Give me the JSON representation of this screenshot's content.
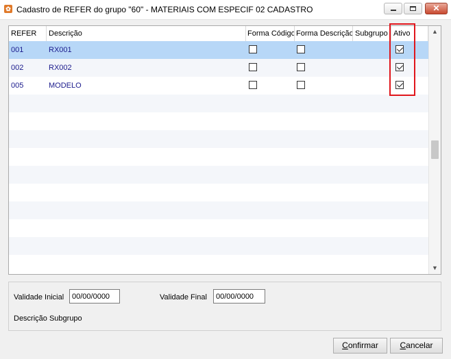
{
  "window": {
    "title": "Cadastro de REFER do grupo \"60\" - MATERIAIS COM ESPECIF 02 CADASTRO",
    "icon": "app-icon",
    "close_glyph": "✕"
  },
  "grid": {
    "columns": [
      "REFER",
      "Descrição",
      "Forma Código",
      "Forma Descrição",
      "Subgrupo",
      "Ativo"
    ],
    "rows": [
      {
        "refer": "001",
        "descricao": "RX001",
        "forma_codigo": false,
        "forma_descricao": false,
        "subgrupo": "",
        "ativo": true,
        "selected": true
      },
      {
        "refer": "002",
        "descricao": "RX002",
        "forma_codigo": false,
        "forma_descricao": false,
        "subgrupo": "",
        "ativo": true,
        "selected": false
      },
      {
        "refer": "005",
        "descricao": "MODELO",
        "forma_codigo": false,
        "forma_descricao": false,
        "subgrupo": "",
        "ativo": true,
        "selected": false
      }
    ],
    "empty_rows": 10,
    "scroll_up_glyph": "▲",
    "scroll_down_glyph": "▼"
  },
  "filters": {
    "validade_inicial_label": "Validade Inicial",
    "validade_inicial_value": "00/00/0000",
    "validade_final_label": "Validade Final",
    "validade_final_value": "00/00/0000",
    "descricao_subgrupo_label": "Descrição Subgrupo"
  },
  "buttons": {
    "confirmar_mnemonic": "C",
    "confirmar_rest": "onfirmar",
    "cancelar_mnemonic": "C",
    "cancelar_rest": "ancelar"
  },
  "colors": {
    "selected_row": "#b7d7f7",
    "highlight_border": "#e0151b",
    "row_text": "#1a1a8c"
  }
}
